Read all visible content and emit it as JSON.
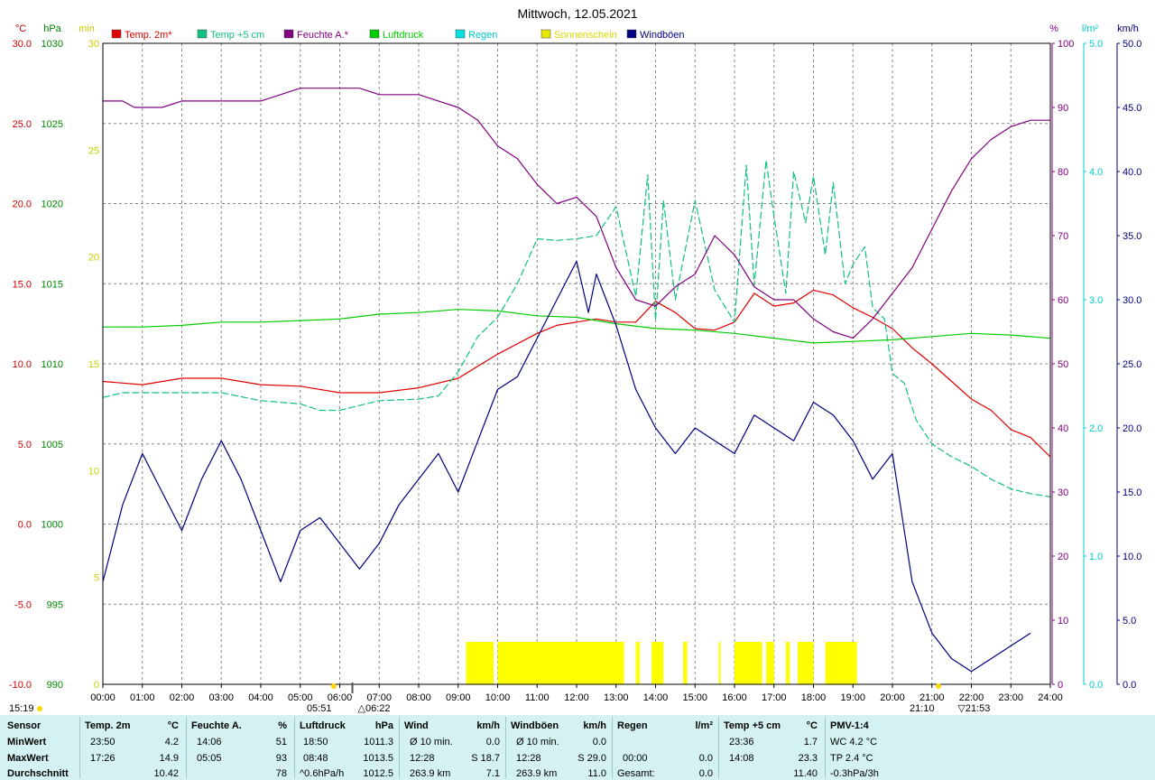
{
  "chart_data": {
    "type": "line",
    "title": "Mittwoch, 12.05.2021",
    "x_axis": {
      "range_hours": [
        0,
        24
      ],
      "tick_labels": [
        "00:00",
        "01:00",
        "02:00",
        "03:00",
        "04:00",
        "05:00",
        "06:00",
        "07:00",
        "08:00",
        "09:00",
        "10:00",
        "11:00",
        "12:00",
        "13:00",
        "14:00",
        "15:00",
        "16:00",
        "17:00",
        "18:00",
        "19:00",
        "20:00",
        "21:00",
        "22:00",
        "23:00",
        "24:00"
      ],
      "sunrise": "05:51",
      "sunrise_twilight": "06:22",
      "sunset": "21:10",
      "sunset_twilight": "21:53",
      "time_left": "15:19"
    },
    "axes": {
      "temp": {
        "unit": "°C",
        "range": [
          -10,
          30
        ],
        "ticks": [
          "30.0",
          "25.0",
          "20.0",
          "15.0",
          "10.0",
          "5.0",
          "0.0",
          "-5.0",
          "-10.0"
        ],
        "color": "#cc0000"
      },
      "press": {
        "unit": "hPa",
        "range": [
          990,
          1030
        ],
        "ticks": [
          "1030",
          "1025",
          "1020",
          "1015",
          "1010",
          "1005",
          "1000",
          "995",
          "990"
        ],
        "color": "#008800"
      },
      "sun": {
        "unit": "min",
        "range": [
          0,
          30
        ],
        "ticks": [
          "30",
          "25",
          "20",
          "15",
          "10",
          "5",
          "0"
        ],
        "color": "#cccc00"
      },
      "hum": {
        "unit": "%",
        "range": [
          0,
          100
        ],
        "ticks": [
          "100",
          "90",
          "80",
          "70",
          "60",
          "50",
          "40",
          "30",
          "20",
          "10",
          "0"
        ],
        "color": "#800080"
      },
      "rain": {
        "unit": "l/m²",
        "range": [
          0,
          5
        ],
        "ticks": [
          "5.0",
          "4.0",
          "3.0",
          "2.0",
          "1.0",
          "0.0"
        ],
        "color": "#00cccc"
      },
      "wind": {
        "unit": "km/h",
        "range": [
          0,
          50
        ],
        "ticks": [
          "50.0",
          "45.0",
          "40.0",
          "35.0",
          "30.0",
          "25.0",
          "20.0",
          "15.0",
          "10.0",
          "5.0",
          "0.0"
        ],
        "color": "#000080"
      }
    },
    "grid": true,
    "legend": [
      {
        "name": "Temp. 2m*",
        "color": "#e00000"
      },
      {
        "name": "Temp +5 cm",
        "color": "#10c080"
      },
      {
        "name": "Feuchte A.*",
        "color": "#800080"
      },
      {
        "name": "Luftdruck",
        "color": "#00cc00"
      },
      {
        "name": "Regen",
        "color": "#00e0e0"
      },
      {
        "name": "Sonnenschein",
        "color": "#e8e800"
      },
      {
        "name": "Windböen",
        "color": "#000080"
      }
    ],
    "series": [
      {
        "name": "Temp. 2m*",
        "axis": "temp",
        "color": "#e00000",
        "style": "solid",
        "x": [
          0,
          1,
          2,
          3,
          4,
          5,
          6,
          7,
          8,
          9,
          10,
          11,
          11.5,
          12,
          12.5,
          13,
          13.5,
          14,
          14.5,
          15,
          15.5,
          16,
          16.5,
          17,
          17.5,
          18,
          18.5,
          19,
          19.5,
          20,
          20.5,
          21,
          21.5,
          22,
          22.5,
          23,
          23.5,
          24
        ],
        "y": [
          8.9,
          8.7,
          9.1,
          9.1,
          8.7,
          8.6,
          8.2,
          8.2,
          8.5,
          9.1,
          10.6,
          11.9,
          12.4,
          12.6,
          12.8,
          12.6,
          12.6,
          13.9,
          13.2,
          12.2,
          12.1,
          12.6,
          14.4,
          13.6,
          13.8,
          14.6,
          14.3,
          13.5,
          12.9,
          12.2,
          11.0,
          10.0,
          8.9,
          7.8,
          7.1,
          5.9,
          5.4,
          4.2
        ]
      },
      {
        "name": "Temp +5 cm",
        "axis": "temp",
        "color": "#10c080",
        "style": "dashed",
        "x": [
          0,
          0.5,
          1,
          2,
          3,
          4,
          5,
          5.5,
          6,
          7,
          8,
          8.5,
          9,
          9.5,
          10,
          10.5,
          11,
          11.5,
          12,
          12.5,
          13,
          13.5,
          13.8,
          14,
          14.2,
          14.5,
          15,
          15.5,
          16,
          16.3,
          16.5,
          16.8,
          17,
          17.3,
          17.5,
          17.8,
          18,
          18.3,
          18.5,
          18.8,
          19,
          19.3,
          19.5,
          19.8,
          20,
          20.3,
          20.6,
          21,
          21.5,
          22,
          22.5,
          23,
          23.5,
          24
        ],
        "y": [
          7.9,
          8.2,
          8.2,
          8.2,
          8.2,
          7.7,
          7.5,
          7.1,
          7.1,
          7.7,
          7.8,
          8.0,
          9.5,
          11.7,
          12.9,
          15.0,
          17.8,
          17.7,
          17.8,
          18.0,
          19.8,
          14.2,
          21.8,
          12.7,
          20.2,
          14.0,
          20.2,
          14.6,
          12.6,
          22.4,
          14.9,
          22.7,
          19.2,
          14.4,
          22.0,
          18.8,
          21.7,
          16.8,
          21.3,
          15.0,
          16.2,
          17.3,
          13.5,
          12.8,
          9.4,
          8.8,
          6.5,
          5.0,
          4.2,
          3.6,
          2.8,
          2.2,
          1.9,
          1.7
        ]
      },
      {
        "name": "Feuchte A.*",
        "axis": "hum",
        "color": "#800080",
        "style": "solid",
        "x": [
          0,
          0.5,
          0.8,
          1.5,
          2,
          3,
          4,
          4.5,
          5,
          5.2,
          6,
          6.5,
          7,
          8,
          8.5,
          9,
          9.5,
          10,
          10.5,
          11,
          11.5,
          12,
          12.5,
          13,
          13.5,
          14,
          14.5,
          15,
          15.5,
          16,
          16.5,
          17,
          17.5,
          18,
          18.5,
          19,
          19.5,
          20,
          20.5,
          21,
          21.5,
          22,
          22.5,
          23,
          23.5,
          24
        ],
        "y": [
          91,
          91,
          90,
          90,
          91,
          91,
          91,
          92,
          93,
          93,
          93,
          93,
          92,
          92,
          91,
          90,
          88,
          84,
          82,
          78,
          75,
          76,
          73,
          65,
          60,
          59,
          62,
          64,
          70,
          67,
          62,
          60,
          60,
          57,
          55,
          54,
          57,
          61,
          65,
          71,
          77,
          82,
          85,
          87,
          88,
          88
        ]
      },
      {
        "name": "Luftdruck",
        "axis": "press",
        "color": "#00cc00",
        "style": "solid",
        "x": [
          0,
          1,
          2,
          3,
          4,
          5,
          6,
          7,
          8,
          9,
          10,
          11,
          12,
          13,
          14,
          15,
          16,
          17,
          18,
          19,
          20,
          21,
          22,
          23,
          24
        ],
        "y": [
          1012.3,
          1012.3,
          1012.4,
          1012.6,
          1012.6,
          1012.7,
          1012.8,
          1013.1,
          1013.2,
          1013.4,
          1013.3,
          1013.0,
          1012.9,
          1012.5,
          1012.2,
          1012.1,
          1011.9,
          1011.6,
          1011.3,
          1011.4,
          1011.5,
          1011.7,
          1011.9,
          1011.8,
          1011.6
        ]
      },
      {
        "name": "Windböen",
        "axis": "wind",
        "color": "#000080",
        "style": "solid",
        "x": [
          0,
          0.5,
          1,
          1.5,
          2,
          2.5,
          3,
          3.5,
          4,
          4.5,
          5,
          5.5,
          6,
          6.5,
          7,
          7.5,
          8,
          8.5,
          9,
          9.5,
          10,
          10.5,
          11,
          11.5,
          12,
          12.3,
          12.5,
          13,
          13.5,
          14,
          14.5,
          15,
          15.5,
          16,
          16.5,
          17,
          17.5,
          18,
          18.5,
          19,
          19.5,
          20,
          20.5,
          21,
          21.5,
          22,
          22.5,
          23,
          23.5
        ],
        "y": [
          8,
          14,
          18,
          15,
          12,
          16,
          19,
          16,
          12,
          8,
          12,
          13,
          11,
          9,
          11,
          14,
          16,
          18,
          15,
          19,
          23,
          24,
          27,
          30,
          33,
          29,
          32,
          28,
          23,
          20,
          18,
          20,
          19,
          18,
          21,
          20,
          19,
          22,
          21,
          19,
          16,
          18,
          8,
          4,
          2,
          1,
          2,
          3,
          4
        ]
      }
    ],
    "sunshine_periods_hours": [
      [
        9.2,
        9.9
      ],
      [
        10.0,
        13.2
      ],
      [
        13.5,
        13.6
      ],
      [
        13.9,
        14.2
      ],
      [
        14.7,
        14.8
      ],
      [
        15.6,
        15.65
      ],
      [
        16.0,
        16.7
      ],
      [
        16.8,
        17.0
      ],
      [
        17.3,
        17.4
      ],
      [
        17.6,
        18.0
      ],
      [
        18.3,
        19.1
      ]
    ]
  },
  "stats": {
    "sensor": {
      "header": "Sensor",
      "rows": [
        "MinWert",
        "MaxWert",
        "Durchschnitt"
      ]
    },
    "temp2m": {
      "header": "Temp. 2m",
      "unit": "°C",
      "rows": [
        [
          "23:50",
          "4.2"
        ],
        [
          "17:26",
          "14.9"
        ],
        [
          "",
          "10.42"
        ]
      ]
    },
    "feuchte": {
      "header": "Feuchte A.",
      "unit": "%",
      "rows": [
        [
          "14:06",
          "51"
        ],
        [
          "05:05",
          "93"
        ],
        [
          "",
          "78"
        ]
      ]
    },
    "luftdruck": {
      "header": "Luftdruck",
      "unit": "hPa",
      "rows": [
        [
          "18:50",
          "1011.3"
        ],
        [
          "08:48",
          "1013.5"
        ],
        [
          "^0.6hPa/h",
          "1012.5"
        ]
      ]
    },
    "wind": {
      "header": "Wind",
      "unit": "km/h",
      "rows": [
        [
          "Ø 10 min.",
          "0.0"
        ],
        [
          "12:28",
          "S 18.7"
        ],
        [
          "263.9 km",
          "7.1"
        ]
      ]
    },
    "windboeen": {
      "header": "Windböen",
      "unit": "km/h",
      "rows": [
        [
          "Ø 10 min.",
          "0.0"
        ],
        [
          "12:28",
          "S 29.0"
        ],
        [
          "263.9 km",
          "11.0"
        ]
      ]
    },
    "regen": {
      "header": "Regen",
      "unit": "l/m²",
      "rows": [
        [
          "",
          ""
        ],
        [
          "00:00",
          "0.0"
        ],
        [
          "Gesamt:",
          "0.0"
        ]
      ]
    },
    "temp5cm": {
      "header": "Temp +5 cm",
      "unit": "°C",
      "rows": [
        [
          "23:36",
          "1.7"
        ],
        [
          "14:08",
          "23.3"
        ],
        [
          "",
          "11.40"
        ]
      ]
    },
    "pmv": {
      "header": "PMV-1:4",
      "rows": [
        "WC 4.2 °C",
        "TP 2.4 °C",
        "-0.3hPa/3h"
      ]
    }
  }
}
